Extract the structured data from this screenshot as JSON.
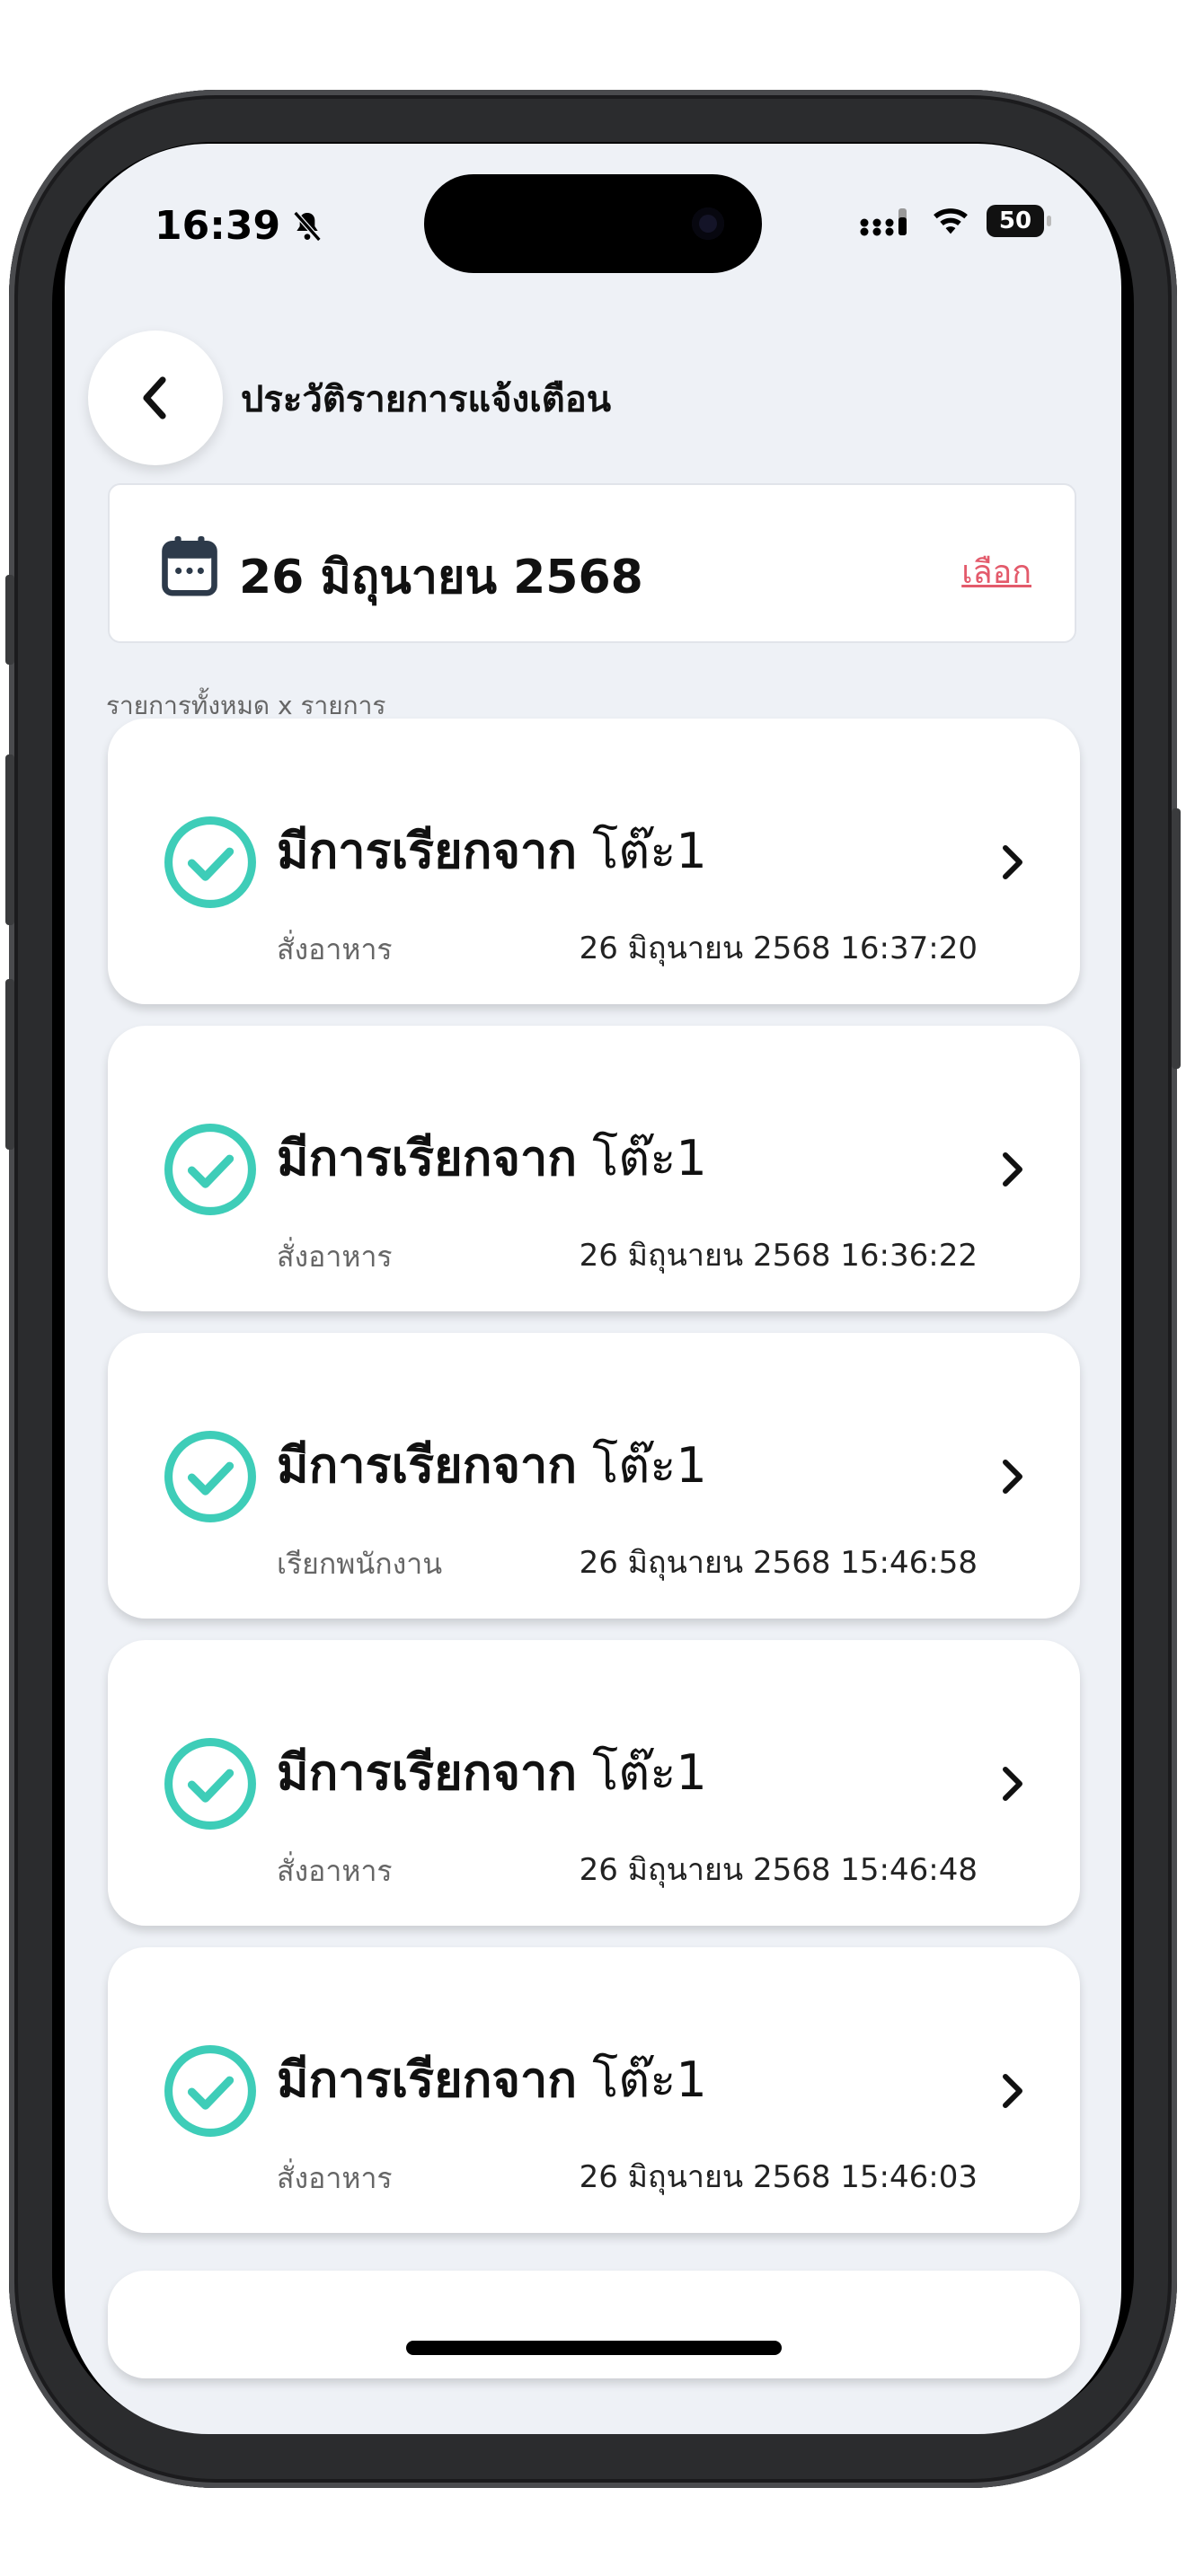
{
  "status_bar": {
    "time": "16:39",
    "battery": "50"
  },
  "header": {
    "title": "ประวัติรายการแจ้งเตือน"
  },
  "date_filter": {
    "date": "26 มิถุนายน 2568",
    "select_label": "เลือก"
  },
  "summary": "รายการทั้งหมด x รายการ",
  "notifications": [
    {
      "title_bold": "มีการเรียกจาก",
      "table": "โต๊ะ1",
      "type": "สั่งอาหาร",
      "timestamp": "26 มิถุนายน 2568 16:37:20"
    },
    {
      "title_bold": "มีการเรียกจาก",
      "table": "โต๊ะ1",
      "type": "สั่งอาหาร",
      "timestamp": "26 มิถุนายน 2568 16:36:22"
    },
    {
      "title_bold": "มีการเรียกจาก",
      "table": "โต๊ะ1",
      "type": "เรียกพนักงาน",
      "timestamp": "26 มิถุนายน 2568 15:46:58"
    },
    {
      "title_bold": "มีการเรียกจาก",
      "table": "โต๊ะ1",
      "type": "สั่งอาหาร",
      "timestamp": "26 มิถุนายน 2568 15:46:48"
    },
    {
      "title_bold": "มีการเรียกจาก",
      "table": "โต๊ะ1",
      "type": "สั่งอาหาร",
      "timestamp": "26 มิถุนายน 2568 15:46:03"
    }
  ],
  "colors": {
    "accent_teal": "#3ecdb8",
    "link_red": "#e35a6b",
    "background": "#eef1f6"
  },
  "icons": {
    "back": "chevron-left-icon",
    "calendar": "calendar-icon",
    "status": "check-circle-icon",
    "row": "chevron-right-icon"
  }
}
